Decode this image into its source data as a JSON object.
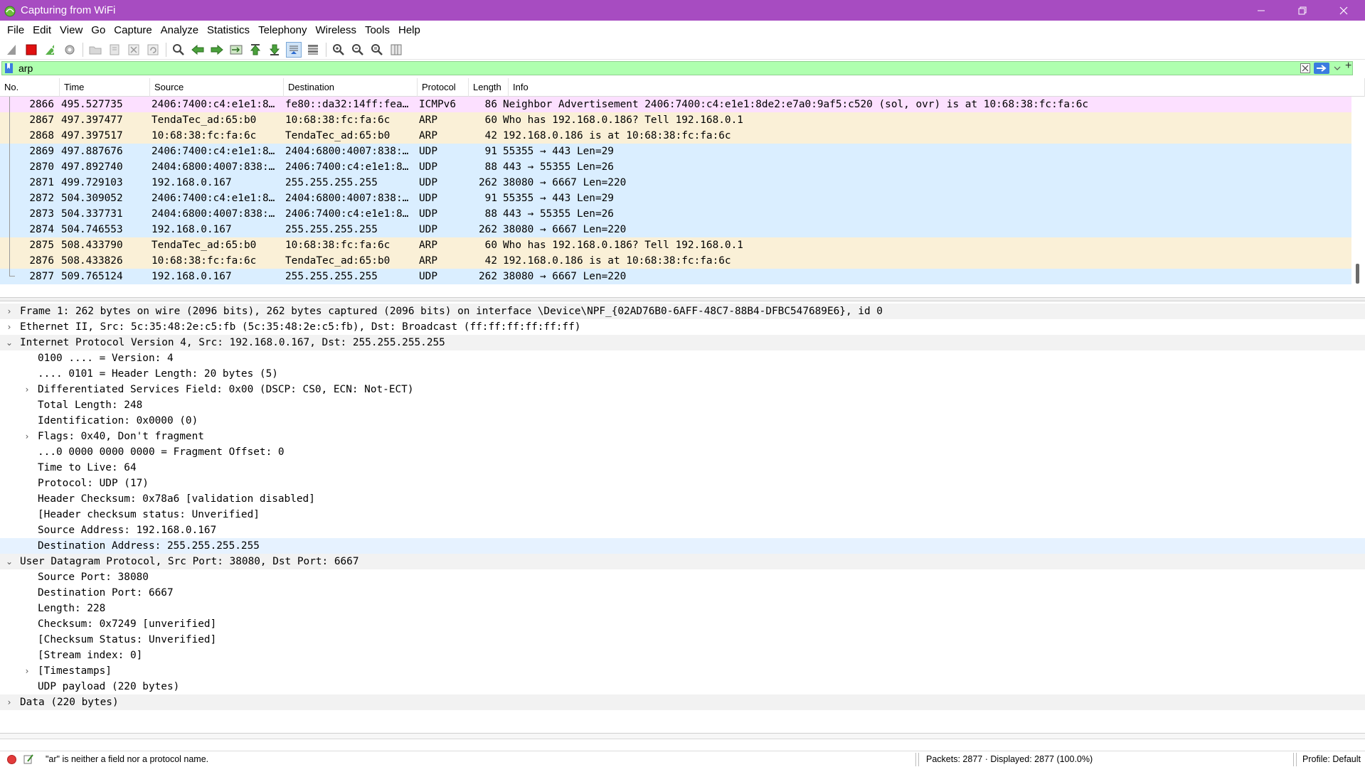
{
  "window": {
    "title": "Capturing from WiFi"
  },
  "menu": [
    "File",
    "Edit",
    "View",
    "Go",
    "Capture",
    "Analyze",
    "Statistics",
    "Telephony",
    "Wireless",
    "Tools",
    "Help"
  ],
  "toolbar": {
    "icons": [
      "shark-fin-start-icon",
      "stop-capture-icon",
      "restart-capture-icon",
      "capture-options-icon",
      "open-file-icon",
      "save-file-icon",
      "close-file-icon",
      "reload-file-icon",
      "find-packet-icon",
      "go-back-icon",
      "go-forward-icon",
      "go-to-packet-icon",
      "go-first-icon",
      "go-last-icon",
      "autoscroll-icon",
      "colorize-icon",
      "zoom-in-icon",
      "zoom-out-icon",
      "normal-size-icon",
      "resize-columns-icon"
    ]
  },
  "filter": {
    "value": "arp",
    "placeholder": ""
  },
  "packet_list": {
    "columns": [
      "No.",
      "Time",
      "Source",
      "Destination",
      "Protocol",
      "Length",
      "Info"
    ],
    "rows": [
      {
        "no": "2866",
        "time": "495.527735",
        "src": "2406:7400:c4:e1e1:8…",
        "dst": "fe80::da32:14ff:fea…",
        "proto": "ICMPv6",
        "len": "86",
        "info": "Neighbor Advertisement 2406:7400:c4:e1e1:8de2:e7a0:9af5:c520 (sol, ovr) is at 10:68:38:fc:fa:6c",
        "kind": "icmp"
      },
      {
        "no": "2867",
        "time": "497.397477",
        "src": "TendaTec_ad:65:b0",
        "dst": "10:68:38:fc:fa:6c",
        "proto": "ARP",
        "len": "60",
        "info": "Who has 192.168.0.186? Tell 192.168.0.1",
        "kind": "arp"
      },
      {
        "no": "2868",
        "time": "497.397517",
        "src": "10:68:38:fc:fa:6c",
        "dst": "TendaTec_ad:65:b0",
        "proto": "ARP",
        "len": "42",
        "info": "192.168.0.186 is at 10:68:38:fc:fa:6c",
        "kind": "arp"
      },
      {
        "no": "2869",
        "time": "497.887676",
        "src": "2406:7400:c4:e1e1:8…",
        "dst": "2404:6800:4007:838:…",
        "proto": "UDP",
        "len": "91",
        "info": "55355 → 443 Len=29",
        "kind": "udp"
      },
      {
        "no": "2870",
        "time": "497.892740",
        "src": "2404:6800:4007:838:…",
        "dst": "2406:7400:c4:e1e1:8…",
        "proto": "UDP",
        "len": "88",
        "info": "443 → 55355 Len=26",
        "kind": "udp"
      },
      {
        "no": "2871",
        "time": "499.729103",
        "src": "192.168.0.167",
        "dst": "255.255.255.255",
        "proto": "UDP",
        "len": "262",
        "info": "38080 → 6667 Len=220",
        "kind": "udp"
      },
      {
        "no": "2872",
        "time": "504.309052",
        "src": "2406:7400:c4:e1e1:8…",
        "dst": "2404:6800:4007:838:…",
        "proto": "UDP",
        "len": "91",
        "info": "55355 → 443 Len=29",
        "kind": "udp"
      },
      {
        "no": "2873",
        "time": "504.337731",
        "src": "2404:6800:4007:838:…",
        "dst": "2406:7400:c4:e1e1:8…",
        "proto": "UDP",
        "len": "88",
        "info": "443 → 55355 Len=26",
        "kind": "udp"
      },
      {
        "no": "2874",
        "time": "504.746553",
        "src": "192.168.0.167",
        "dst": "255.255.255.255",
        "proto": "UDP",
        "len": "262",
        "info": "38080 → 6667 Len=220",
        "kind": "udp"
      },
      {
        "no": "2875",
        "time": "508.433790",
        "src": "TendaTec_ad:65:b0",
        "dst": "10:68:38:fc:fa:6c",
        "proto": "ARP",
        "len": "60",
        "info": "Who has 192.168.0.186? Tell 192.168.0.1",
        "kind": "arp"
      },
      {
        "no": "2876",
        "time": "508.433826",
        "src": "10:68:38:fc:fa:6c",
        "dst": "TendaTec_ad:65:b0",
        "proto": "ARP",
        "len": "42",
        "info": "192.168.0.186 is at 10:68:38:fc:fa:6c",
        "kind": "arp"
      },
      {
        "no": "2877",
        "time": "509.765124",
        "src": "192.168.0.167",
        "dst": "255.255.255.255",
        "proto": "UDP",
        "len": "262",
        "info": "38080 → 6667 Len=220",
        "kind": "udp"
      }
    ]
  },
  "details": [
    {
      "level": 0,
      "arrow": "collapsed",
      "text": "Frame 1: 262 bytes on wire (2096 bits), 262 bytes captured (2096 bits) on interface \\Device\\NPF_{02AD76B0-6AFF-48C7-88B4-DFBC547689E6}, id 0",
      "style": "hl"
    },
    {
      "level": 0,
      "arrow": "collapsed",
      "text": "Ethernet II, Src: 5c:35:48:2e:c5:fb (5c:35:48:2e:c5:fb), Dst: Broadcast (ff:ff:ff:ff:ff:ff)",
      "style": ""
    },
    {
      "level": 0,
      "arrow": "expanded",
      "text": "Internet Protocol Version 4, Src: 192.168.0.167, Dst: 255.255.255.255",
      "style": "hl"
    },
    {
      "level": 1,
      "arrow": "",
      "text": "0100 .... = Version: 4",
      "style": ""
    },
    {
      "level": 1,
      "arrow": "",
      "text": ".... 0101 = Header Length: 20 bytes (5)",
      "style": ""
    },
    {
      "level": 1,
      "arrow": "collapsed",
      "text": "Differentiated Services Field: 0x00 (DSCP: CS0, ECN: Not-ECT)",
      "style": ""
    },
    {
      "level": 1,
      "arrow": "",
      "text": "Total Length: 248",
      "style": ""
    },
    {
      "level": 1,
      "arrow": "",
      "text": "Identification: 0x0000 (0)",
      "style": ""
    },
    {
      "level": 1,
      "arrow": "collapsed",
      "text": "Flags: 0x40, Don't fragment",
      "style": ""
    },
    {
      "level": 1,
      "arrow": "",
      "text": "...0 0000 0000 0000 = Fragment Offset: 0",
      "style": ""
    },
    {
      "level": 1,
      "arrow": "",
      "text": "Time to Live: 64",
      "style": ""
    },
    {
      "level": 1,
      "arrow": "",
      "text": "Protocol: UDP (17)",
      "style": ""
    },
    {
      "level": 1,
      "arrow": "",
      "text": "Header Checksum: 0x78a6 [validation disabled]",
      "style": ""
    },
    {
      "level": 1,
      "arrow": "",
      "text": "[Header checksum status: Unverified]",
      "style": ""
    },
    {
      "level": 1,
      "arrow": "",
      "text": "Source Address: 192.168.0.167",
      "style": ""
    },
    {
      "level": 1,
      "arrow": "",
      "text": "Destination Address: 255.255.255.255",
      "style": "sel"
    },
    {
      "level": 0,
      "arrow": "expanded",
      "text": "User Datagram Protocol, Src Port: 38080, Dst Port: 6667",
      "style": "hl"
    },
    {
      "level": 1,
      "arrow": "",
      "text": "Source Port: 38080",
      "style": ""
    },
    {
      "level": 1,
      "arrow": "",
      "text": "Destination Port: 6667",
      "style": ""
    },
    {
      "level": 1,
      "arrow": "",
      "text": "Length: 228",
      "style": ""
    },
    {
      "level": 1,
      "arrow": "",
      "text": "Checksum: 0x7249 [unverified]",
      "style": ""
    },
    {
      "level": 1,
      "arrow": "",
      "text": "[Checksum Status: Unverified]",
      "style": ""
    },
    {
      "level": 1,
      "arrow": "",
      "text": "[Stream index: 0]",
      "style": ""
    },
    {
      "level": 1,
      "arrow": "collapsed",
      "text": "[Timestamps]",
      "style": ""
    },
    {
      "level": 1,
      "arrow": "",
      "text": "UDP payload (220 bytes)",
      "style": ""
    },
    {
      "level": 0,
      "arrow": "collapsed",
      "text": "Data (220 bytes)",
      "style": "hl"
    }
  ],
  "status": {
    "message": "\"ar\" is neither a field nor a protocol name.",
    "packets": "Packets: 2877 · Displayed: 2877 (100.0%)",
    "profile": "Profile: Default"
  },
  "colors": {
    "titlebar": "#a74cc1",
    "filter_valid_bg": "#afffaf",
    "row_icmp": "#fce0ff",
    "row_arp": "#faf0d7",
    "row_udp": "#daeeff"
  }
}
